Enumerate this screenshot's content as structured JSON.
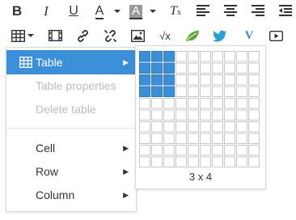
{
  "toolbar": {
    "row1": [
      "bold-icon",
      "italic-icon",
      "underline-icon",
      "text-color-icon",
      "background-color-icon",
      "clear-formatting-icon",
      "align-left-icon",
      "align-center-icon",
      "align-right-icon",
      "outdent-icon"
    ],
    "row2": [
      "table-icon",
      "media-icon",
      "link-icon",
      "unlink-icon",
      "image-icon",
      "math-formula-icon",
      "leaf-icon",
      "twitter-icon",
      "vimeo-icon",
      "video-icon"
    ],
    "formula_text": "√x"
  },
  "menu": {
    "items": [
      {
        "label": "Table",
        "state": "active",
        "submenu": true
      },
      {
        "label": "Table properties",
        "state": "disabled",
        "submenu": false
      },
      {
        "label": "Delete table",
        "state": "disabled",
        "submenu": false
      },
      {
        "label": "Cell",
        "state": "normal",
        "submenu": true
      },
      {
        "label": "Row",
        "state": "normal",
        "submenu": true
      },
      {
        "label": "Column",
        "state": "normal",
        "submenu": true
      }
    ],
    "submenu_arrow": "▶"
  },
  "table_grid": {
    "columns": 10,
    "rows": 10,
    "selected_columns": 3,
    "selected_rows": 4,
    "label": "3 x 4",
    "selected_color": "#3b8fd8",
    "cell_border_color": "#c8c8c8"
  },
  "colors": {
    "accent": "#3b8fd8",
    "leaf": "#5aa32f",
    "twitter": "#2a9fd6",
    "vimeo": "#3a8fd0"
  }
}
